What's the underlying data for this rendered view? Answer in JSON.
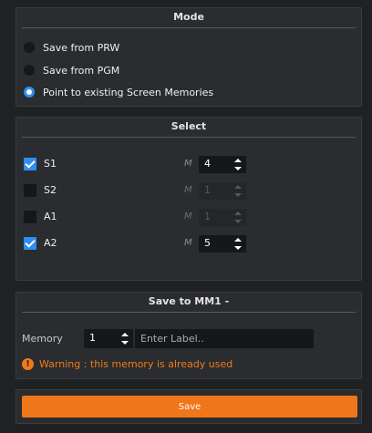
{
  "mode": {
    "title": "Mode",
    "options": [
      {
        "label": "Save from PRW",
        "checked": false
      },
      {
        "label": "Save from PGM",
        "checked": false
      },
      {
        "label": "Point to existing Screen Memories",
        "checked": true
      }
    ]
  },
  "select": {
    "title": "Select",
    "m_letter": "M",
    "rows": [
      {
        "name": "S1",
        "checked": true,
        "value": "4",
        "enabled": true
      },
      {
        "name": "S2",
        "checked": false,
        "value": "1",
        "enabled": false
      },
      {
        "name": "A1",
        "checked": false,
        "value": "1",
        "enabled": false
      },
      {
        "name": "A2",
        "checked": true,
        "value": "5",
        "enabled": true
      }
    ]
  },
  "save": {
    "title": "Save to MM1 -",
    "memory_label": "Memory",
    "memory_value": "1",
    "label_placeholder": "Enter Label..",
    "warning_icon": "!",
    "warning_text": "Warning : this memory is already used"
  },
  "button": {
    "save_label": "Save"
  },
  "colors": {
    "accent": "#2f8ff0",
    "warning": "#f07a1a",
    "save_button": "#f0761a"
  }
}
